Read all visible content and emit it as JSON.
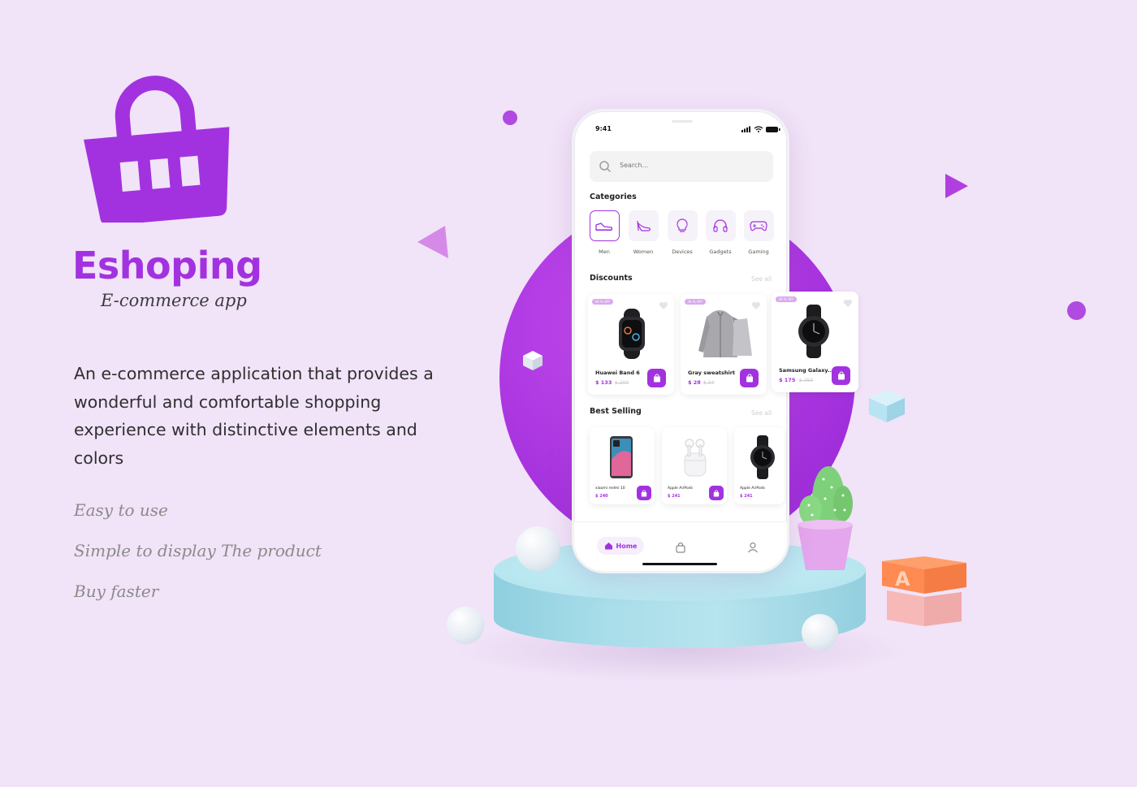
{
  "brand": {
    "title": "Eshoping",
    "subtitle": "E-commerce app",
    "description": "An e-commerce application that provides a wonderful and comfortable shopping experience with distinctive elements and colors",
    "features": [
      "Easy to use",
      "Simple to display The product",
      "Buy faster"
    ],
    "accent_color": "#a232df",
    "background_color": "#f1e3f8"
  },
  "phone": {
    "status_time": "9:41",
    "search": {
      "placeholder": "Search..."
    },
    "categories": {
      "title": "Categories",
      "items": [
        {
          "label": "Men",
          "icon": "sneaker-icon",
          "active": true
        },
        {
          "label": "Women",
          "icon": "high-heel-icon",
          "active": false
        },
        {
          "label": "Devices",
          "icon": "lightbulb-icon",
          "active": false
        },
        {
          "label": "Gadgets",
          "icon": "headphones-icon",
          "active": false
        },
        {
          "label": "Gaming",
          "icon": "gamepad-icon",
          "active": false
        }
      ]
    },
    "discounts": {
      "title": "Discounts",
      "see_all": "See all",
      "items": [
        {
          "badge": "30 % OFF",
          "name": "Huawei Band 6",
          "price": "$ 133",
          "old_price": "$ 200",
          "image": "smart-band-image"
        },
        {
          "badge": "30 % OFF",
          "name": "Gray sweatshirt",
          "price": "$ 28",
          "old_price": "$ 34",
          "image": "hoodie-image"
        },
        {
          "badge": "30 % OFF",
          "name": "Samsung Galaxy..",
          "price": "$ 175",
          "old_price": "$ 250",
          "image": "smartwatch-image"
        }
      ]
    },
    "best_selling": {
      "title": "Best Selling",
      "see_all": "See all",
      "items": [
        {
          "name": "xiaomi redmi 10",
          "price": "$ 240",
          "image": "phone-image"
        },
        {
          "name": "Apple AirPods",
          "price": "$ 241",
          "image": "airpods-image"
        },
        {
          "name": "Apple AirPods",
          "price": "$ 241",
          "image": "smartwatch-image"
        }
      ]
    },
    "tabbar": {
      "home_label": "Home",
      "items": [
        "home-icon",
        "bag-icon",
        "profile-icon"
      ]
    }
  }
}
